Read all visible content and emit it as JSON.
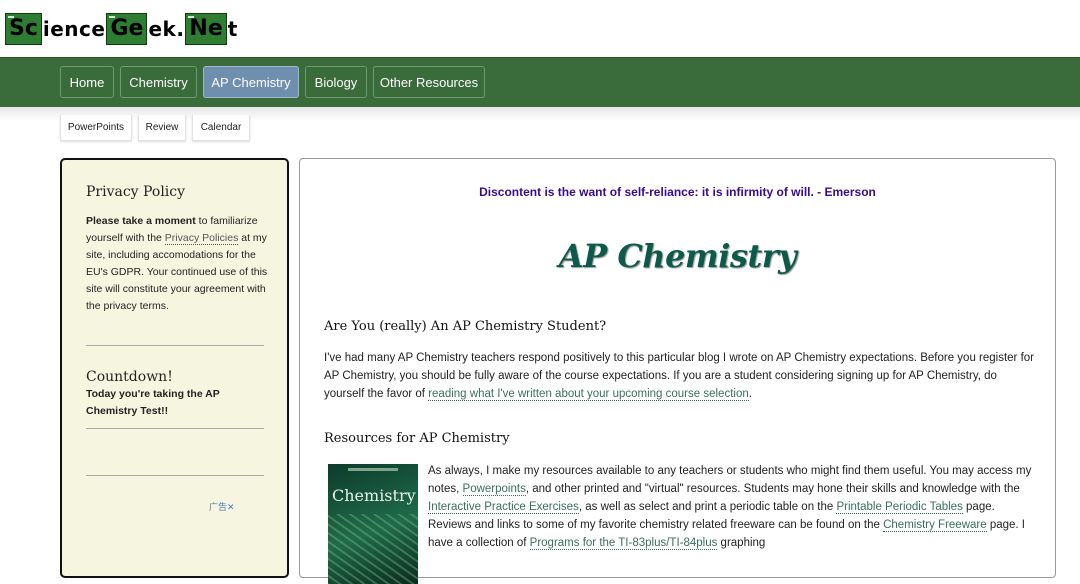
{
  "logo": {
    "el1": "Sc",
    "t1": "ience",
    "el2": "Ge",
    "t2": "ek.",
    "el3": "Ne",
    "t3": "t"
  },
  "nav": {
    "tabs": [
      "Home",
      "Chemistry",
      "AP Chemistry",
      "Biology",
      "Other Resources"
    ],
    "active": "AP Chemistry",
    "sub": [
      "PowerPoints",
      "Review",
      "Calendar"
    ]
  },
  "sidebar": {
    "privacy_title": "Privacy Policy",
    "privacy_bold": "Please take a moment",
    "privacy_t1": " to familiarize yourself with the ",
    "privacy_link": "Privacy Policies",
    "privacy_t2": " at my site, including accomodations for the EU's GDPR. Your continued use of this site will constitute your agreement with the privacy terms.",
    "countdown_title": "Countdown!",
    "countdown_text": "Today you're taking the AP Chemistry Test!!",
    "ad_label": "广告✕"
  },
  "main": {
    "quote": "Discontent is the want of self-reliance: it is infirmity of will. - Emerson",
    "title": "AP Chemistry",
    "h_student": "Are You (really) An AP Chemistry Student?",
    "p1_text": "I've had many AP Chemistry teachers respond positively to this particular blog I wrote on AP Chemistry expectations. Before you register for AP Chemistry, you should be fully aware of the course expectations. If you are a student considering signing up for AP Chemistry, do yourself the favor of ",
    "p1_link": "reading what I've written about your upcoming course selection",
    "p1_end": ".",
    "h_resources": "Resources for AP Chemistry",
    "book_title": "Chemistry",
    "p2_a": "As always, I make my resources available to any teachers or students who might find them useful. You may access my notes, ",
    "p2_link1": "Powerpoints",
    "p2_b": ", and other printed and \"virtual\" resources. Students may hone their skills and knowledge with the ",
    "p2_link2": "Interactive Practice Exercises",
    "p2_c": ", as well as select and print a periodic table on the ",
    "p2_link3": "Printable Periodic Tables",
    "p2_d": " page. Reviews and links to some of my favorite chemistry related freeware can be found on the ",
    "p2_link4": "Chemistry Freeware",
    "p2_e": " page. I have a collection of ",
    "p2_link5": "Programs for the TI-83plus/TI-84plus",
    "p2_f": " graphing"
  }
}
